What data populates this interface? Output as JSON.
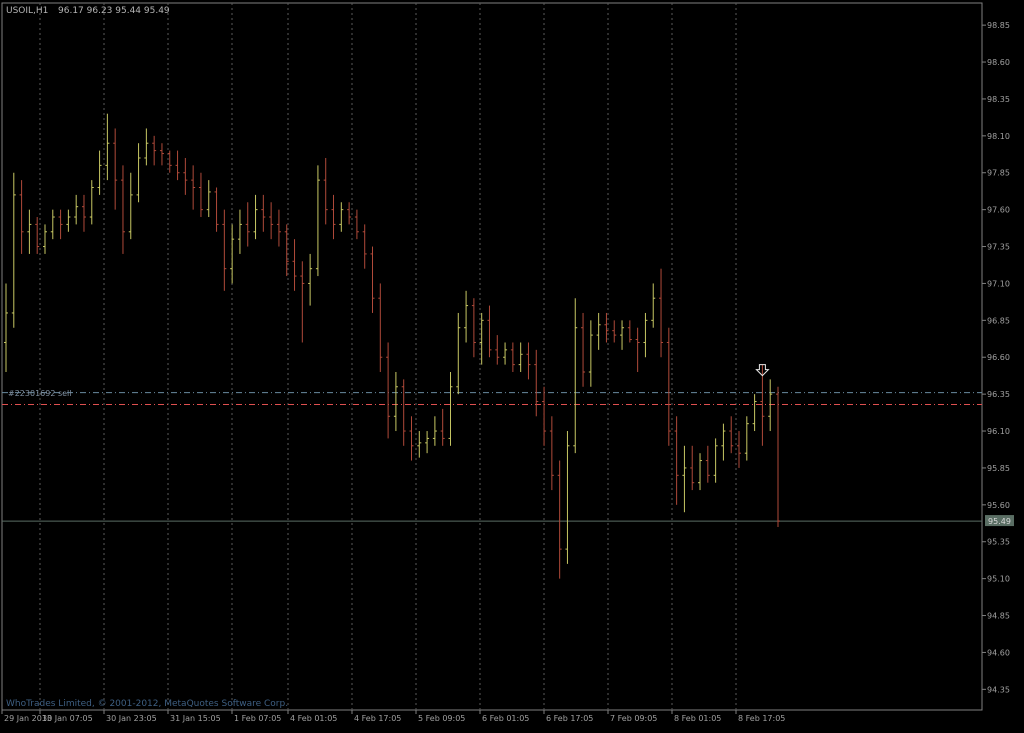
{
  "header": {
    "symbol": "USOIL,H1",
    "ohlc": "96.17 96.23 95.44 95.49"
  },
  "footer": {
    "copyright": "WhoTrades Limited, © 2001-2012, MetaQuotes Software Corp."
  },
  "order_label": "#22301692 sell",
  "colors": {
    "background": "#000000",
    "frame": "#808080",
    "grid": "#5a5a5a",
    "text": "#a0a0a0",
    "bull": "#c8c864",
    "bear": "#b04a3a",
    "bid_line": "#5a6e64",
    "order_line": "#6a8aa0",
    "sl_line": "#e05050"
  },
  "chart_data": {
    "type": "candlestick",
    "symbol": "USOIL",
    "timeframe": "H1",
    "ylim": [
      94.21,
      99.0
    ],
    "yticks": [
      "98.85",
      "98.60",
      "98.35",
      "98.10",
      "97.85",
      "97.60",
      "97.35",
      "97.10",
      "96.85",
      "96.60",
      "96.35",
      "96.10",
      "95.85",
      "95.60",
      "95.35",
      "95.10",
      "94.85",
      "94.60",
      "94.35"
    ],
    "xticks": [
      "29 Jan 2013",
      "30 Jan 07:05",
      "30 Jan 23:05",
      "31 Jan 15:05",
      "1 Feb 07:05",
      "4 Feb 01:05",
      "4 Feb 17:05",
      "5 Feb 09:05",
      "6 Feb 01:05",
      "6 Feb 17:05",
      "7 Feb 09:05",
      "8 Feb 01:05",
      "8 Feb 17:05"
    ],
    "current_price": "95.49",
    "order_price": 96.36,
    "stop_price": 96.28,
    "bars": [
      [
        96.7,
        97.1,
        96.5,
        96.9
      ],
      [
        96.9,
        97.85,
        96.8,
        97.7
      ],
      [
        97.7,
        97.8,
        97.3,
        97.45
      ],
      [
        97.45,
        97.6,
        97.3,
        97.5
      ],
      [
        97.5,
        97.55,
        97.3,
        97.35
      ],
      [
        97.35,
        97.5,
        97.3,
        97.45
      ],
      [
        97.45,
        97.6,
        97.4,
        97.55
      ],
      [
        97.55,
        97.6,
        97.4,
        97.5
      ],
      [
        97.5,
        97.6,
        97.45,
        97.55
      ],
      [
        97.55,
        97.7,
        97.5,
        97.62
      ],
      [
        97.62,
        97.7,
        97.45,
        97.55
      ],
      [
        97.55,
        97.8,
        97.5,
        97.75
      ],
      [
        97.75,
        98.0,
        97.7,
        97.9
      ],
      [
        97.9,
        98.25,
        97.8,
        98.05
      ],
      [
        98.05,
        98.15,
        97.6,
        97.8
      ],
      [
        97.8,
        97.9,
        97.3,
        97.45
      ],
      [
        97.45,
        97.85,
        97.4,
        97.7
      ],
      [
        97.7,
        98.05,
        97.65,
        97.95
      ],
      [
        97.95,
        98.15,
        97.9,
        98.05
      ],
      [
        98.05,
        98.1,
        97.9,
        98.0
      ],
      [
        98.0,
        98.05,
        97.9,
        97.98
      ],
      [
        97.98,
        98.0,
        97.85,
        97.9
      ],
      [
        97.9,
        98.0,
        97.8,
        97.85
      ],
      [
        97.85,
        97.95,
        97.7,
        97.8
      ],
      [
        97.8,
        97.9,
        97.6,
        97.75
      ],
      [
        97.75,
        97.85,
        97.55,
        97.6
      ],
      [
        97.6,
        97.8,
        97.55,
        97.72
      ],
      [
        97.72,
        97.75,
        97.45,
        97.5
      ],
      [
        97.5,
        97.6,
        97.05,
        97.2
      ],
      [
        97.2,
        97.5,
        97.1,
        97.4
      ],
      [
        97.4,
        97.6,
        97.3,
        97.5
      ],
      [
        97.5,
        97.65,
        97.35,
        97.45
      ],
      [
        97.45,
        97.7,
        97.4,
        97.6
      ],
      [
        97.6,
        97.7,
        97.45,
        97.55
      ],
      [
        97.55,
        97.65,
        97.4,
        97.5
      ],
      [
        97.5,
        97.6,
        97.35,
        97.45
      ],
      [
        97.45,
        97.5,
        97.15,
        97.25
      ],
      [
        97.25,
        97.4,
        97.05,
        97.15
      ],
      [
        97.15,
        97.25,
        96.7,
        97.1
      ],
      [
        97.1,
        97.3,
        96.95,
        97.2
      ],
      [
        97.2,
        97.9,
        97.15,
        97.8
      ],
      [
        97.8,
        97.95,
        97.5,
        97.6
      ],
      [
        97.6,
        97.7,
        97.4,
        97.5
      ],
      [
        97.5,
        97.65,
        97.45,
        97.6
      ],
      [
        97.6,
        97.65,
        97.5,
        97.55
      ],
      [
        97.55,
        97.6,
        97.4,
        97.45
      ],
      [
        97.45,
        97.5,
        97.2,
        97.3
      ],
      [
        97.3,
        97.35,
        96.9,
        97.0
      ],
      [
        97.0,
        97.1,
        96.5,
        96.6
      ],
      [
        96.6,
        96.7,
        96.05,
        96.2
      ],
      [
        96.2,
        96.5,
        96.1,
        96.4
      ],
      [
        96.4,
        96.45,
        96.0,
        96.1
      ],
      [
        96.1,
        96.2,
        95.9,
        96.0
      ],
      [
        96.0,
        96.1,
        95.92,
        96.02
      ],
      [
        96.02,
        96.1,
        95.95,
        96.05
      ],
      [
        96.05,
        96.2,
        96.0,
        96.1
      ],
      [
        96.1,
        96.25,
        96.0,
        96.05
      ],
      [
        96.05,
        96.5,
        96.0,
        96.4
      ],
      [
        96.4,
        96.9,
        96.35,
        96.8
      ],
      [
        96.8,
        97.05,
        96.7,
        96.95
      ],
      [
        96.95,
        97.0,
        96.6,
        96.7
      ],
      [
        96.7,
        96.9,
        96.55,
        96.85
      ],
      [
        96.85,
        96.95,
        96.6,
        96.65
      ],
      [
        96.65,
        96.75,
        96.55,
        96.6
      ],
      [
        96.6,
        96.7,
        96.55,
        96.65
      ],
      [
        96.65,
        96.7,
        96.5,
        96.55
      ],
      [
        96.55,
        96.7,
        96.5,
        96.62
      ],
      [
        96.62,
        96.7,
        96.45,
        96.55
      ],
      [
        96.55,
        96.65,
        96.2,
        96.3
      ],
      [
        96.3,
        96.4,
        96.0,
        96.1
      ],
      [
        96.1,
        96.2,
        95.7,
        95.8
      ],
      [
        95.8,
        95.9,
        95.1,
        95.3
      ],
      [
        95.3,
        96.1,
        95.2,
        96.0
      ],
      [
        96.0,
        97.0,
        95.95,
        96.8
      ],
      [
        96.8,
        96.9,
        96.4,
        96.5
      ],
      [
        96.5,
        96.85,
        96.4,
        96.75
      ],
      [
        96.75,
        96.9,
        96.65,
        96.82
      ],
      [
        96.82,
        96.9,
        96.7,
        96.78
      ],
      [
        96.78,
        96.85,
        96.7,
        96.75
      ],
      [
        96.75,
        96.85,
        96.65,
        96.8
      ],
      [
        96.8,
        96.85,
        96.7,
        96.72
      ],
      [
        96.72,
        96.8,
        96.5,
        96.7
      ],
      [
        96.7,
        96.9,
        96.6,
        96.85
      ],
      [
        96.85,
        97.1,
        96.8,
        97.0
      ],
      [
        97.0,
        97.2,
        96.6,
        96.7
      ],
      [
        96.7,
        96.8,
        96.0,
        96.1
      ],
      [
        96.1,
        96.2,
        95.6,
        95.8
      ],
      [
        95.8,
        96.0,
        95.55,
        95.85
      ],
      [
        95.85,
        96.0,
        95.7,
        95.75
      ],
      [
        95.75,
        95.95,
        95.7,
        95.9
      ],
      [
        95.9,
        96.0,
        95.75,
        95.8
      ],
      [
        95.8,
        96.05,
        95.75,
        96.0
      ],
      [
        96.0,
        96.15,
        95.9,
        96.1
      ],
      [
        96.1,
        96.2,
        95.95,
        96.0
      ],
      [
        96.0,
        96.1,
        95.85,
        95.95
      ],
      [
        95.95,
        96.2,
        95.9,
        96.15
      ],
      [
        96.15,
        96.35,
        96.1,
        96.3
      ],
      [
        96.3,
        96.55,
        96.0,
        96.2
      ],
      [
        96.2,
        96.45,
        96.1,
        96.35
      ],
      [
        96.35,
        96.4,
        95.45,
        95.49
      ]
    ]
  }
}
